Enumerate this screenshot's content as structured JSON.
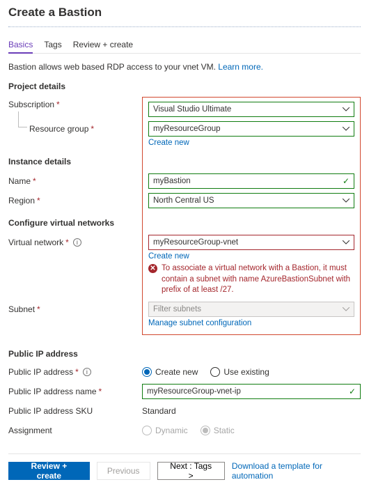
{
  "header": {
    "title": "Create a Bastion"
  },
  "tabs": [
    {
      "label": "Basics",
      "active": true
    },
    {
      "label": "Tags",
      "active": false
    },
    {
      "label": "Review + create",
      "active": false
    }
  ],
  "intro": {
    "text": "Bastion allows web based RDP access to your vnet VM.  ",
    "link": "Learn more."
  },
  "sections": {
    "project": {
      "title": "Project details",
      "subscription_label": "Subscription",
      "subscription_value": "Visual Studio Ultimate",
      "rg_label": "Resource group",
      "rg_value": "myResourceGroup",
      "rg_create_link": "Create new"
    },
    "instance": {
      "title": "Instance details",
      "name_label": "Name",
      "name_value": "myBastion",
      "region_label": "Region",
      "region_value": "North Central US"
    },
    "vnet": {
      "title": "Configure virtual networks",
      "vnet_label": "Virtual network",
      "vnet_value": "myResourceGroup-vnet",
      "vnet_create_link": "Create new",
      "vnet_error": "To associate a virtual network with a Bastion, it must contain a subnet with name AzureBastionSubnet with prefix of at least /27.",
      "subnet_label": "Subnet",
      "subnet_placeholder": "Filter subnets",
      "subnet_manage_link": "Manage subnet configuration"
    },
    "pip": {
      "title": "Public IP address",
      "pip_label": "Public IP address",
      "pip_create_new": "Create new",
      "pip_use_existing": "Use existing",
      "pip_name_label": "Public IP address name",
      "pip_name_value": "myResourceGroup-vnet-ip",
      "sku_label": "Public IP address SKU",
      "sku_value": "Standard",
      "assign_label": "Assignment",
      "assign_dynamic": "Dynamic",
      "assign_static": "Static"
    }
  },
  "footer": {
    "review": "Review + create",
    "previous": "Previous",
    "next": "Next : Tags >",
    "download": "Download a template for automation"
  }
}
